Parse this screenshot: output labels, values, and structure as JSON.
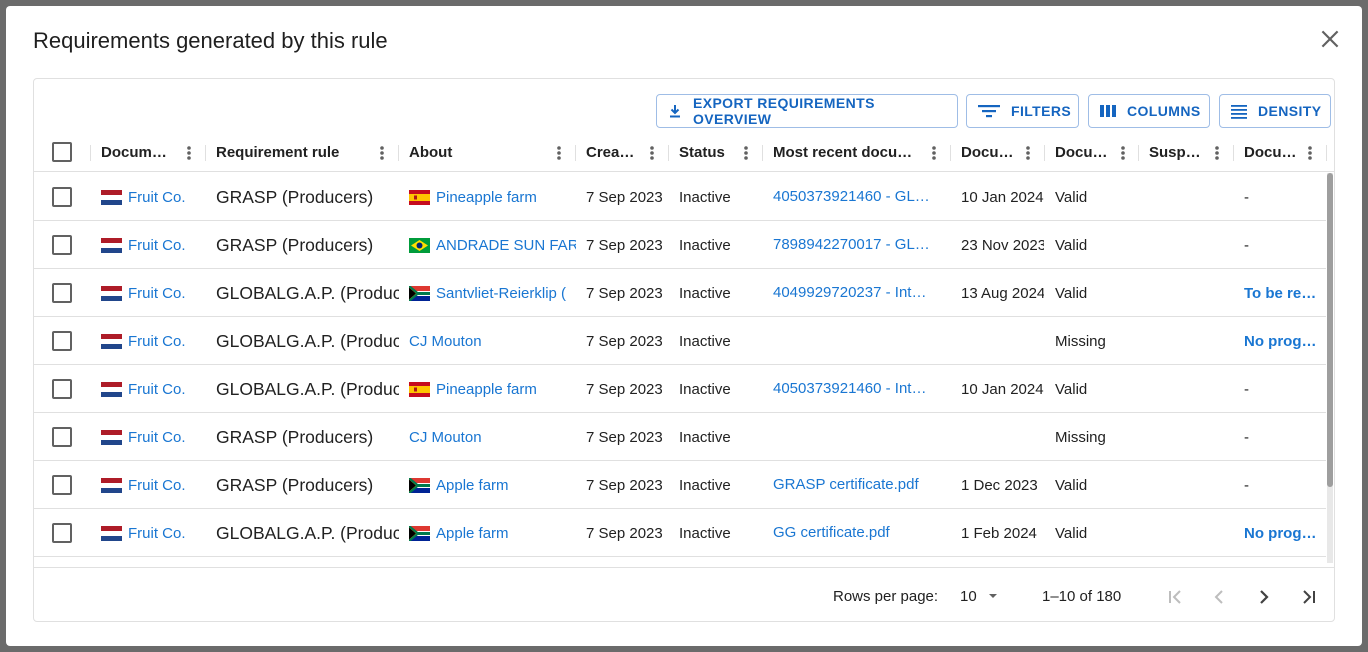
{
  "dialog": {
    "title": "Requirements generated by this rule"
  },
  "toolbar": {
    "export_label": "EXPORT REQUIREMENTS OVERVIEW",
    "filters_label": "FILTERS",
    "columns_label": "COLUMNS",
    "density_label": "DENSITY"
  },
  "columns": [
    "Docum…",
    "Requirement rule",
    "About",
    "Crea…",
    "Status",
    "Most recent docu…",
    "Docu…",
    "Docu…",
    "Susp…",
    "Docu…"
  ],
  "rows": [
    {
      "doc": "Fruit Co.",
      "rule": "GRASP (Producers)",
      "about_flag": "es",
      "about": "Pineapple farm",
      "created": "7 Sep 2023",
      "status": "Inactive",
      "recent": "4050373921460 - GL…",
      "date": "10 Jan 2024",
      "doc_status": "Valid",
      "susp": "",
      "last": "-",
      "last_link": false
    },
    {
      "doc": "Fruit Co.",
      "rule": "GRASP (Producers)",
      "about_flag": "br",
      "about": "ANDRADE SUN FAR",
      "created": "7 Sep 2023",
      "status": "Inactive",
      "recent": "7898942270017 - GL…",
      "date": "23 Nov 2023",
      "doc_status": "Valid",
      "susp": "",
      "last": "-",
      "last_link": false
    },
    {
      "doc": "Fruit Co.",
      "rule": "GLOBALG.A.P. (Produc",
      "about_flag": "za",
      "about": "Santvliet-Reierklip (",
      "created": "7 Sep 2023",
      "status": "Inactive",
      "recent": "4049929720237 - Int…",
      "date": "13 Aug 2024",
      "doc_status": "Valid",
      "susp": "",
      "last": "To be re…",
      "last_link": true
    },
    {
      "doc": "Fruit Co.",
      "rule": "GLOBALG.A.P. (Produc",
      "about_flag": "",
      "about": "CJ Mouton",
      "created": "7 Sep 2023",
      "status": "Inactive",
      "recent": "",
      "date": "",
      "doc_status": "Missing",
      "susp": "",
      "last": "No prog…",
      "last_link": true
    },
    {
      "doc": "Fruit Co.",
      "rule": "GLOBALG.A.P. (Produc",
      "about_flag": "es",
      "about": "Pineapple farm",
      "created": "7 Sep 2023",
      "status": "Inactive",
      "recent": "4050373921460 - Int…",
      "date": "10 Jan 2024",
      "doc_status": "Valid",
      "susp": "",
      "last": "-",
      "last_link": false
    },
    {
      "doc": "Fruit Co.",
      "rule": "GRASP (Producers)",
      "about_flag": "",
      "about": "CJ Mouton",
      "created": "7 Sep 2023",
      "status": "Inactive",
      "recent": "",
      "date": "",
      "doc_status": "Missing",
      "susp": "",
      "last": "-",
      "last_link": false
    },
    {
      "doc": "Fruit Co.",
      "rule": "GRASP (Producers)",
      "about_flag": "za",
      "about": "Apple farm",
      "created": "7 Sep 2023",
      "status": "Inactive",
      "recent": "GRASP certificate.pdf",
      "date": "1 Dec 2023",
      "doc_status": "Valid",
      "susp": "",
      "last": "-",
      "last_link": false
    },
    {
      "doc": "Fruit Co.",
      "rule": "GLOBALG.A.P. (Produc",
      "about_flag": "za",
      "about": "Apple farm",
      "created": "7 Sep 2023",
      "status": "Inactive",
      "recent": "GG certificate.pdf",
      "date": "1 Feb 2024",
      "doc_status": "Valid",
      "susp": "",
      "last": "No prog…",
      "last_link": true
    }
  ],
  "footer": {
    "rows_per_page_label": "Rows per page:",
    "rows_per_page_value": "10",
    "range": "1–10 of 180"
  },
  "icons": {
    "close": "close-icon",
    "export": "download-icon",
    "filters": "filter-icon",
    "columns": "columns-icon",
    "density": "density-icon",
    "first": "first-page-icon",
    "prev": "chevron-left-icon",
    "next": "chevron-right-icon",
    "last": "last-page-icon"
  },
  "colors": {
    "accent": "#1976d2",
    "text": "#212121",
    "divider": "#e0e0e0"
  }
}
